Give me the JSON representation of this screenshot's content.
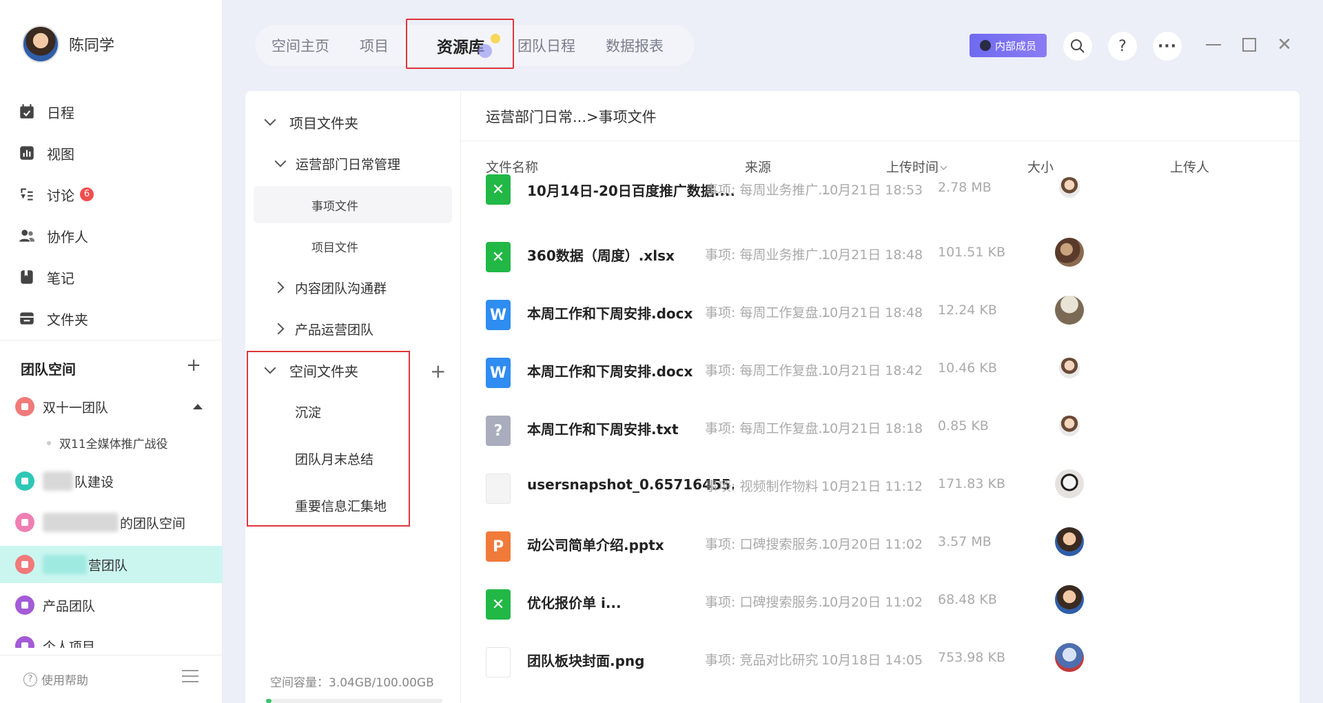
{
  "user": {
    "name": "陈同学"
  },
  "nav": [
    {
      "label": "日程"
    },
    {
      "label": "视图"
    },
    {
      "label": "讨论",
      "badge": "6"
    },
    {
      "label": "协作人"
    },
    {
      "label": "笔记"
    },
    {
      "label": "文件夹"
    }
  ],
  "team_section": {
    "title": "团队空间",
    "teams": [
      {
        "label": "双十一团队",
        "color": "#f07a7a"
      },
      {
        "label": "队建设",
        "color": "#2fc7b5"
      },
      {
        "label": "的团队空间",
        "color": "#ef7fb3"
      },
      {
        "label": "营团队",
        "color": "#f07a7a"
      },
      {
        "label": "产品团队",
        "color": "#a35bd6"
      },
      {
        "label": "个人项目",
        "color": "#a35bd6"
      }
    ],
    "sub_item": "双11全媒体推广战役"
  },
  "help": "使用帮助",
  "tabs": [
    "空间主页",
    "项目",
    "资源库",
    "团队日程",
    "数据报表"
  ],
  "member_badge": "内部成员",
  "folder_tree": {
    "project_folder": "项目文件夹",
    "ops_daily": "运营部门日常管理",
    "item_files": "事项文件",
    "project_files": "项目文件",
    "content_group": "内容团队沟通群",
    "product_ops": "产品运营团队",
    "space_folder": "空间文件夹",
    "space_children": [
      "沉淀",
      "团队月末总结",
      "重要信息汇集地"
    ]
  },
  "capacity": "空间容量：3.04GB/100.00GB",
  "capacity_ratio": 0.0304,
  "breadcrumb": "运营部门日常...>事项文件",
  "columns": {
    "name": "文件名称",
    "source": "来源",
    "time": "上传时间",
    "size": "大小",
    "uploader": "上传人"
  },
  "files": [
    {
      "name": "10月14日-20日百度推广数据....",
      "type": "xlsx",
      "source": "事项: 每周业务推广...",
      "time": "10月21日 18:53",
      "size": "2.78 MB"
    },
    {
      "name": "360数据（周度）.xlsx",
      "type": "xlsx",
      "source": "事项: 每周业务推广...",
      "time": "10月21日 18:48",
      "size": "101.51 KB"
    },
    {
      "name": "本周工作和下周安排.docx",
      "type": "docx",
      "source": "事项: 每周工作复盘...",
      "time": "10月21日 18:48",
      "size": "12.24 KB"
    },
    {
      "name": "本周工作和下周安排.docx",
      "type": "docx",
      "source": "事项: 每周工作复盘...",
      "time": "10月21日 18:42",
      "size": "10.46 KB"
    },
    {
      "name": "本周工作和下周安排.txt",
      "type": "txt",
      "source": "事项: 每周工作复盘...",
      "time": "10月21日 18:18",
      "size": "0.85 KB"
    },
    {
      "name": "usersnapshot_0.65716455...",
      "type": "img",
      "source": "事项: 视频制作物料",
      "time": "10月21日 11:12",
      "size": "171.83 KB"
    },
    {
      "name": "动公司简单介绍.pptx",
      "type": "pptx",
      "source": "事项: 口碑搜索服务...",
      "time": "10月20日 11:02",
      "size": "3.57 MB"
    },
    {
      "name": "优化报价单 i...",
      "type": "xlsx",
      "source": "事项: 口碑搜索服务...",
      "time": "10月20日 11:02",
      "size": "68.48 KB"
    },
    {
      "name": "团队板块封面.png",
      "type": "png",
      "source": "事项: 竞品对比研究",
      "time": "10月18日 14:05",
      "size": "753.98 KB"
    }
  ],
  "colors": {
    "xlsx": "#21b845",
    "docx": "#2f8cf0",
    "txt": "#a9adbd",
    "pptx": "#f07a3a",
    "accent": "#7b6cf2",
    "highlight": "#e0343a"
  }
}
